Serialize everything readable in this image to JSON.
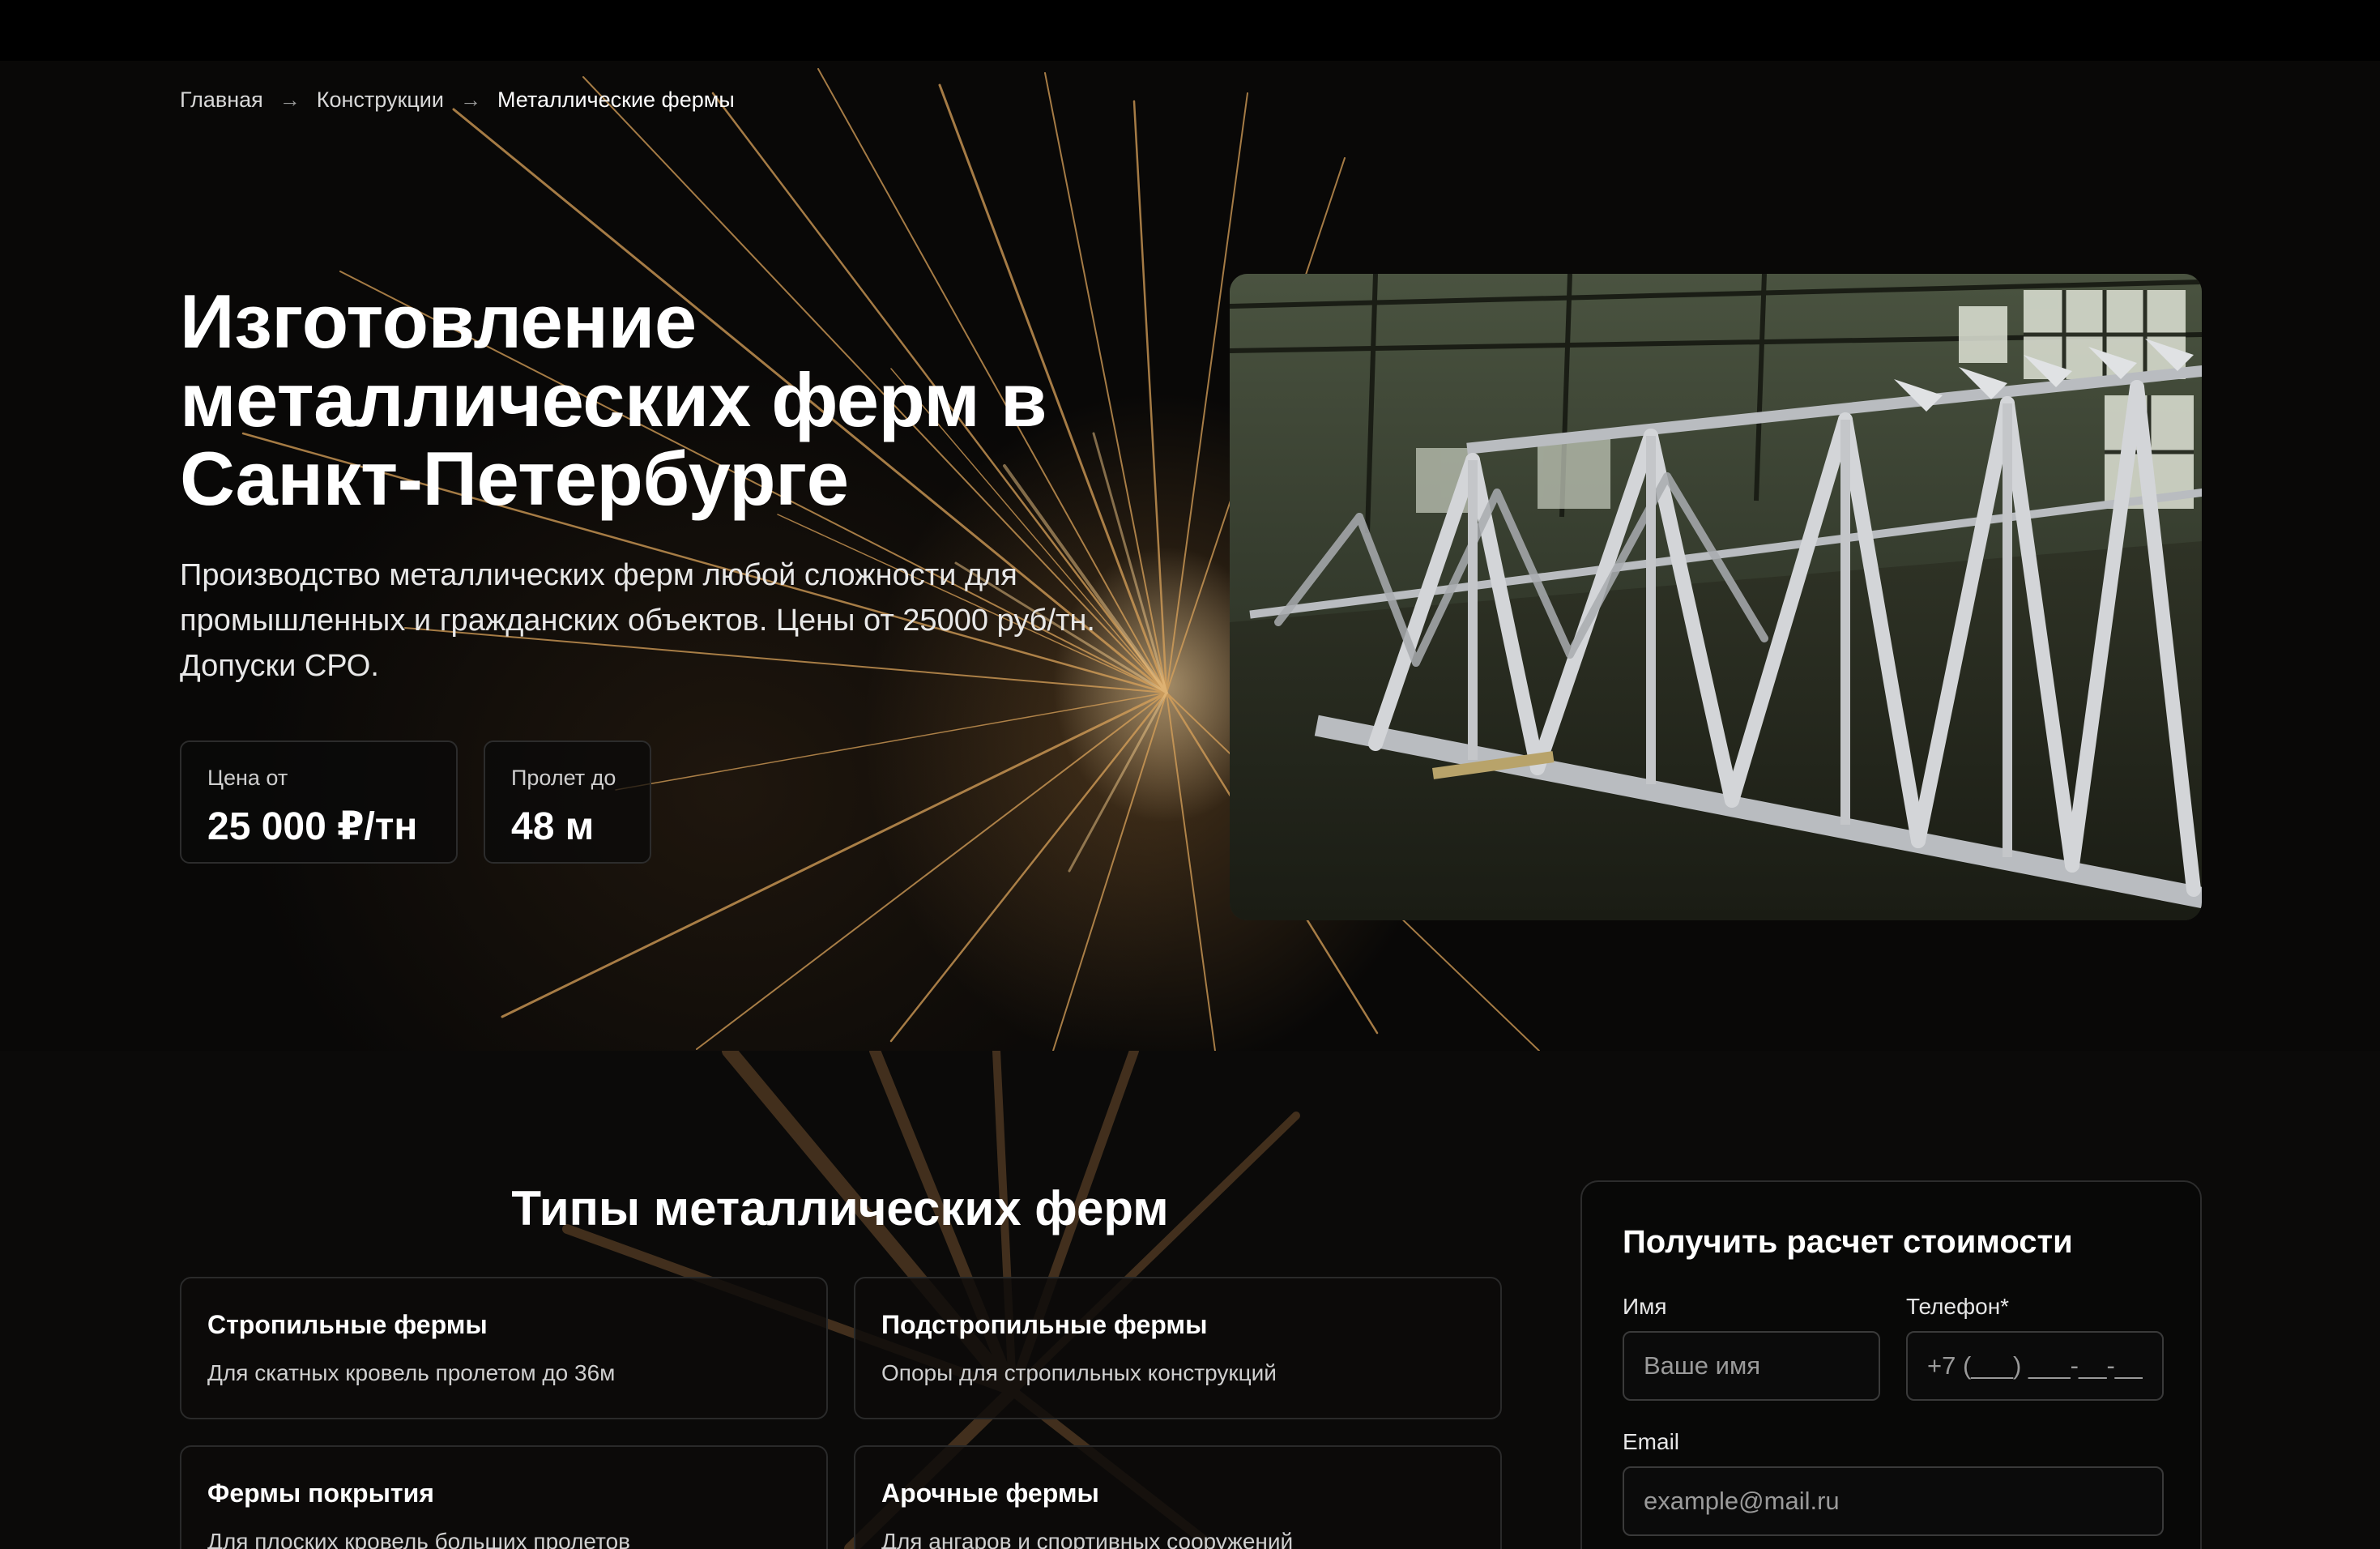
{
  "colors": {
    "background": "#070707",
    "top_bar": "#000000",
    "text_primary": "#ffffff",
    "text_secondary": "#cfcfcf",
    "card_border": "#2c2c2c",
    "spark_accent": "#d9a25a"
  },
  "breadcrumb": {
    "items": [
      {
        "label": "Главная"
      },
      {
        "label": "Конструкции"
      },
      {
        "label": "Металлические фермы"
      }
    ],
    "separator_icon": "arrow-right-icon"
  },
  "hero": {
    "title": "Изготовление\nметаллических ферм в\nСанкт-Петербурге",
    "description": "Производство металлических ферм любой сложности для\nпромышленных и гражданских объектов. Цены от 25000 руб/тн.\nДопуски СРО.",
    "stats": [
      {
        "label": "Цена от",
        "value": "25 000 ₽/тн"
      },
      {
        "label": "Пролет до",
        "value": "48 м"
      }
    ]
  },
  "types_section": {
    "title": "Типы металлических ферм",
    "cards": [
      {
        "title": "Стропильные фермы",
        "description": "Для скатных кровель пролетом до 36м"
      },
      {
        "title": "Подстропильные фермы",
        "description": "Опоры для стропильных конструкций"
      },
      {
        "title": "Фермы покрытия",
        "description": "Для плоских кровель больших пролетов"
      },
      {
        "title": "Арочные фермы",
        "description": "Для ангаров и спортивных сооружений"
      }
    ]
  },
  "form": {
    "title": "Получить расчет стоимости",
    "name": {
      "label": "Имя",
      "placeholder": "Ваше имя",
      "value": ""
    },
    "phone": {
      "label": "Телефон*",
      "placeholder": "+7 (___) ___-__-__",
      "value": ""
    },
    "email": {
      "label": "Email",
      "placeholder": "example@mail.ru",
      "value": ""
    }
  }
}
